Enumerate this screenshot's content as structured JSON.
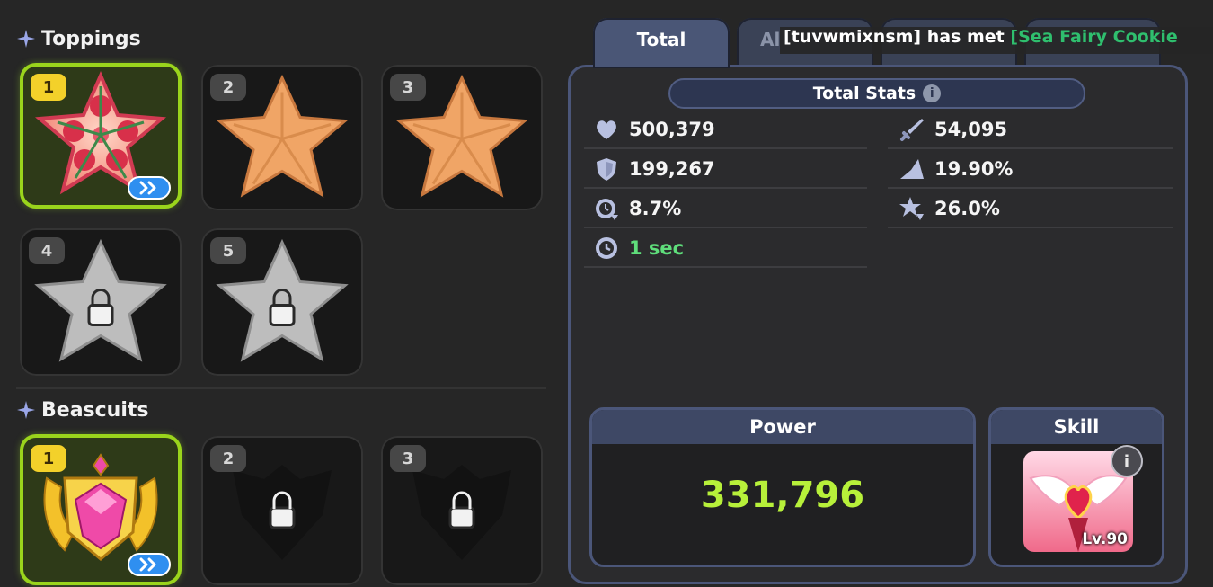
{
  "toppings": {
    "title": "Toppings",
    "slots": [
      {
        "number": "1",
        "state": "equipped",
        "item": "rose-topping"
      },
      {
        "number": "2",
        "state": "empty",
        "item": "empty-topping-star"
      },
      {
        "number": "3",
        "state": "empty",
        "item": "empty-topping-star"
      },
      {
        "number": "4",
        "state": "locked",
        "item": "locked-topping-star"
      },
      {
        "number": "5",
        "state": "locked",
        "item": "locked-topping-star"
      }
    ]
  },
  "beascuits": {
    "title": "Beascuits",
    "slots": [
      {
        "number": "1",
        "state": "equipped",
        "item": "pink-gem-beascuit"
      },
      {
        "number": "2",
        "state": "locked",
        "item": "locked-beascuit"
      },
      {
        "number": "3",
        "state": "locked",
        "item": "locked-beascuit"
      }
    ]
  },
  "tabs": [
    {
      "label": "Total",
      "active": true
    },
    {
      "label": "Al",
      "active": false
    },
    {
      "label": "",
      "active": false
    },
    {
      "label": "",
      "active": false
    }
  ],
  "notice": {
    "prefix": "[tuvwmixnsm] has met ",
    "highlight": "[Sea Fairy Cookie"
  },
  "stats_panel": {
    "header": "Total Stats",
    "info_glyph": "i",
    "left": [
      {
        "icon": "heart-icon",
        "value": "500,379"
      },
      {
        "icon": "shield-icon",
        "value": "199,267"
      },
      {
        "icon": "cooldown-icon",
        "value": "8.7%"
      },
      {
        "icon": "clock-icon",
        "value": "1 sec",
        "color": "#5fde7b"
      }
    ],
    "right": [
      {
        "icon": "sword-icon",
        "value": "54,095"
      },
      {
        "icon": "crit-icon",
        "value": "19.90%"
      },
      {
        "icon": "dmg-resist-icon",
        "value": "26.0%"
      }
    ]
  },
  "power": {
    "label": "Power",
    "value": "331,796"
  },
  "skill": {
    "label": "Skill",
    "level": "Lv.90",
    "info_glyph": "i"
  },
  "colors": {
    "accent_green": "#9ad41c",
    "power_value": "#b7f03a",
    "cooldown_green": "#5fde7b",
    "panel_border": "#4b5679",
    "notice_highlight": "#2fbf6e"
  }
}
